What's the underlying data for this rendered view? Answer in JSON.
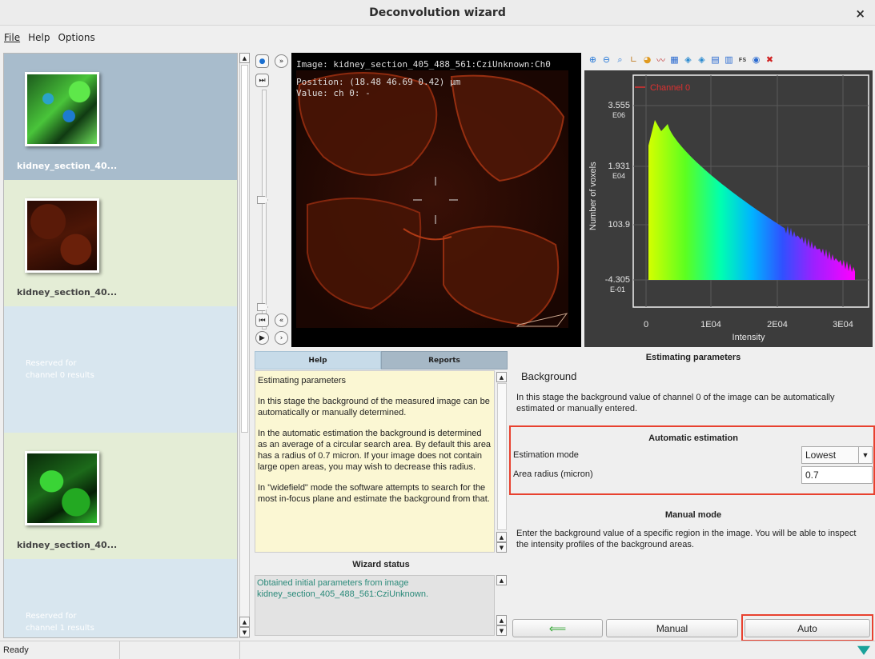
{
  "window": {
    "title": "Deconvolution wizard",
    "close_glyph": "×"
  },
  "menu": {
    "file": "File",
    "help": "Help",
    "options": "Options"
  },
  "thumbnails": [
    {
      "label": "kidney_section_40...",
      "selected": true
    },
    {
      "label": "kidney_section_40...",
      "selected": false
    },
    {
      "label": "kidney_section_40...",
      "selected": false
    }
  ],
  "reserved": [
    {
      "line1": "Reserved for",
      "line2": "channel 0 results"
    },
    {
      "line1": "Reserved for",
      "line2": "channel 1 results"
    }
  ],
  "viewer": {
    "image_line": "Image: kidney_section_405_488_561:CziUnknown:Ch0",
    "position_line": "Position: (18.48 46.69 0.42) µm",
    "value_line": "Value: ch 0: -"
  },
  "histogram": {
    "legend": "Channel 0",
    "ylabel": "Number of voxels",
    "xlabel": "Intensity",
    "y_ticks": [
      {
        "a": "3.555",
        "b": "E06"
      },
      {
        "a": "1.931",
        "b": "E04"
      },
      {
        "a": "103.9",
        "b": ""
      },
      {
        "a": "-4.305",
        "b": "E-01"
      }
    ],
    "x_ticks": [
      "0",
      "1E04",
      "2E04",
      "3E04"
    ],
    "colors": {
      "background": "#3c3c3c",
      "legend": "#e03030",
      "low": "#c8ff00",
      "mid": "#00c8ff",
      "high": "#e000ff"
    }
  },
  "tabs": {
    "help": "Help",
    "reports": "Reports"
  },
  "help_text": [
    "Estimating parameters",
    "In this stage the background of the measured image can be automatically or manually determined.",
    "In the automatic estimation the background is determined as an average of a circular search area. By default this area has a radius of 0.7 micron. If your image does not contain large open areas, you may wish to decrease this radius.",
    "In \"widefield\" mode the software attempts to search for the most in-focus plane and estimate the background from that."
  ],
  "wizard_status": {
    "title": "Wizard status",
    "text": "Obtained initial parameters from image kidney_section_405_488_561:CziUnknown."
  },
  "params": {
    "title": "Estimating parameters",
    "section": "Background",
    "description": "In this stage the background value of channel 0 of the image can be automatically estimated or manually entered.",
    "auto_title": "Automatic estimation",
    "estimation_mode_label": "Estimation mode",
    "estimation_mode_value": "Lowest",
    "area_radius_label": "Area radius (micron)",
    "area_radius_value": "0.7",
    "manual_title": "Manual mode",
    "manual_description": "Enter the background value of a specific region in the image. You will be able to inspect the intensity profiles of the background areas."
  },
  "buttons": {
    "back": "⟸",
    "manual": "Manual",
    "auto": "Auto"
  },
  "status": {
    "text": "Ready"
  },
  "accent": {
    "highlight": "#e8412f",
    "selected_thumb_bg": "#a8bccc",
    "thumb_bg": "#e4edd6",
    "reserved_bg": "#d8e6ef"
  }
}
